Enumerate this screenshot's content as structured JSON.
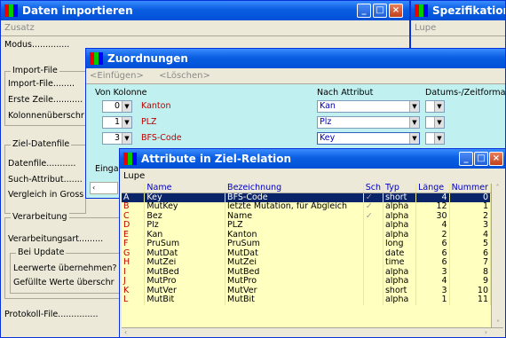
{
  "win_import": {
    "title": "Daten importieren",
    "menu": "Zusatz",
    "labels": [
      "Modus..............",
      "Import-File",
      "Import-File........",
      "Erste Zeile...........",
      "Kolonnenüberschr",
      "Ziel-Datenfile",
      "Datenfile...........",
      "Such-Attribut.......",
      "Vergleich in Gross",
      "Verarbeitung",
      "Verarbeitungsart.........",
      "Bei Update",
      "Leerwerte übernehmen?",
      "Gefüllte Werte überschr",
      "Protokoll-File...............",
      "Eingabe"
    ]
  },
  "win_spez": {
    "title": "Spezifikationen",
    "menu": "Lupe"
  },
  "win_zuord": {
    "title": "Zuordnungen",
    "menu_einfuegen": "<Einfügen>",
    "menu_loeschen": "<Löschen>",
    "col_von": "Von Kolonne",
    "col_nach": "Nach Attribut",
    "col_datum": "Datums-/Zeitformat",
    "rows": [
      {
        "num": "0",
        "src": "Kanton",
        "attr": "Kan"
      },
      {
        "num": "1",
        "src": "PLZ",
        "attr": "Plz"
      },
      {
        "num": "3",
        "src": "BFS-Code",
        "attr": "Key"
      }
    ],
    "eingabe": "Eingabe"
  },
  "win_attr": {
    "title": "Attribute in Ziel-Relation",
    "menu": "Lupe",
    "headers": [
      "Name",
      "Bezeichnung",
      "Sch",
      "Typ",
      "Länge",
      "Nummer"
    ],
    "rows": [
      [
        "A",
        "Key",
        "BFS-Code",
        "short",
        "4",
        "0"
      ],
      [
        "B",
        "MutKey",
        "letzte Mutation, für Abgleich",
        "alpha",
        "12",
        "1"
      ],
      [
        "C",
        "Bez",
        "Name",
        "alpha",
        "30",
        "2"
      ],
      [
        "D",
        "Plz",
        "PLZ",
        "alpha",
        "4",
        "3"
      ],
      [
        "E",
        "Kan",
        "Kanton",
        "alpha",
        "2",
        "4"
      ],
      [
        "F",
        "PruSum",
        "PruSum",
        "long",
        "6",
        "5"
      ],
      [
        "G",
        "MutDat",
        "MutDat",
        "date",
        "6",
        "6"
      ],
      [
        "H",
        "MutZei",
        "MutZei",
        "time",
        "6",
        "7"
      ],
      [
        "I",
        "MutBed",
        "MutBed",
        "alpha",
        "3",
        "8"
      ],
      [
        "J",
        "MutPro",
        "MutPro",
        "alpha",
        "4",
        "9"
      ],
      [
        "K",
        "MutVer",
        "MutVer",
        "short",
        "3",
        "10"
      ],
      [
        "L",
        "MutBit",
        "MutBit",
        "alpha",
        "1",
        "11"
      ]
    ],
    "checked_rows": [
      0,
      1,
      2
    ]
  },
  "colors": {
    "title_active": "#0050d8",
    "grid_bg": "#ffffc0",
    "row_selected": "#0a246a",
    "aqua_bg": "#c0f0f0"
  }
}
